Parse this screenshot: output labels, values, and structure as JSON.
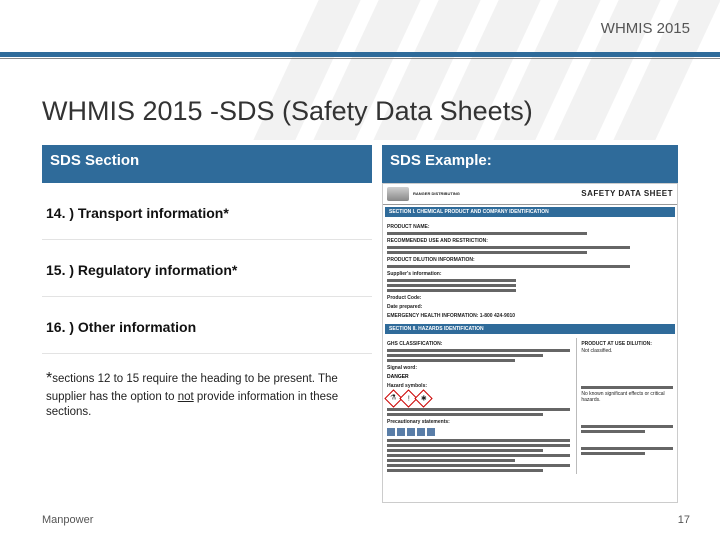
{
  "header": {
    "label": "WHMIS 2015"
  },
  "title": "WHMIS 2015 -SDS (Safety Data Sheets)",
  "columns": {
    "left_header": "SDS Section",
    "right_header": "SDS Example:"
  },
  "sections": [
    "14. ) Transport information*",
    "15. ) Regulatory information*",
    "16. ) Other information"
  ],
  "footnote": {
    "star": "*",
    "text_a": "sections 12 to 15 require the heading to be present. The supplier has the option to ",
    "underlined": "not",
    "text_b": " provide information in these sections."
  },
  "sds_doc": {
    "brand": "RANGER DISTRIBUTING",
    "title": "SAFETY DATA SHEET",
    "section1": "SECTION I. CHEMICAL PRODUCT AND COMPANY IDENTIFICATION",
    "section2": "SECTION II. HAZARDS IDENTIFICATION",
    "labels": {
      "product_name": "PRODUCT NAME:",
      "recommended": "RECOMMENDED USE AND RESTRICTION:",
      "dilution": "PRODUCT DILUTION INFORMATION:",
      "supplier": "Supplier's information:",
      "product_code": "Product Code:",
      "date": "Date prepared:",
      "emergency": "EMERGENCY HEALTH INFORMATION: 1-800 424-9010",
      "classification": "GHS CLASSIFICATION:",
      "signal": "Signal word:",
      "signal_value": "DANGER",
      "hazard_symbols": "Hazard symbols:",
      "precautionary": "Precautionary statements:",
      "use_dilution": "PRODUCT AT USE DILUTION:",
      "not_classified": "Not classified.",
      "no_hazard": "No known significant effects or critical hazards."
    }
  },
  "footer": {
    "left": "Manpower",
    "page": "17"
  }
}
